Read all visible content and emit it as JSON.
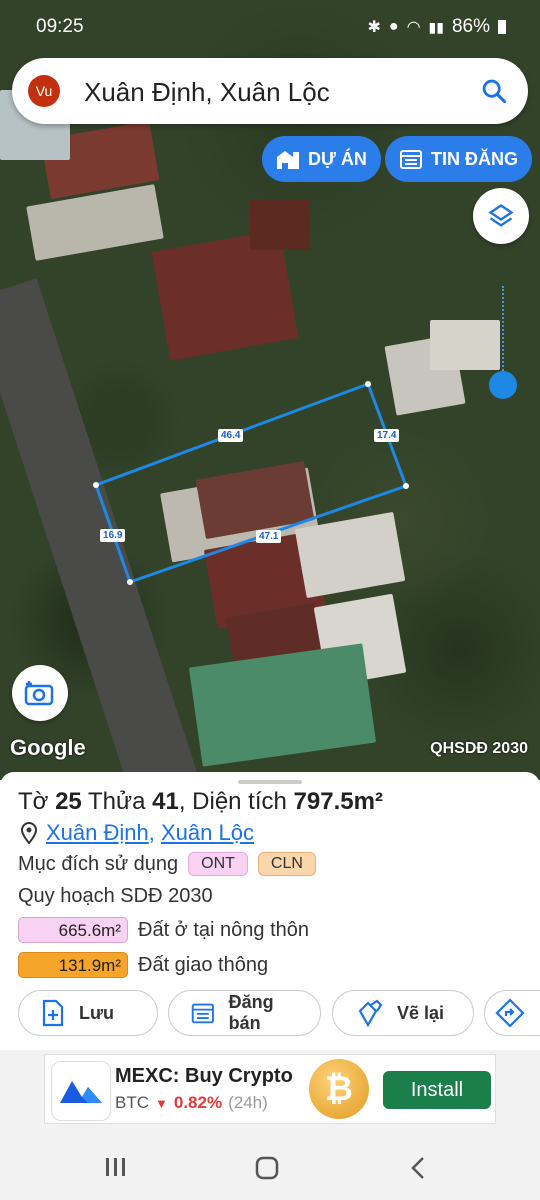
{
  "status": {
    "time": "09:25",
    "battery": "86%"
  },
  "search": {
    "avatar": "Vu",
    "query": "Xuân Định, Xuân Lộc"
  },
  "buttons": {
    "du_an": "DỰ ÁN",
    "tin_dang": "TIN ĐĂNG"
  },
  "map": {
    "attribution": "Google",
    "layer_label": "QHSDĐ 2030",
    "edges": {
      "top": "46.4",
      "right": "17.4",
      "left": "16.9",
      "bottom": "47.1"
    }
  },
  "parcel": {
    "sheet_prefix": "Tờ",
    "sheet_no": "25",
    "plot_prefix": "Thửa",
    "plot_no": "41",
    "area_prefix": "Diện tích",
    "area": "797.5m²",
    "commune": "Xuân Định",
    "separator": ",",
    "district": "Xuân Lộc",
    "usage_label": "Mục đích sử dụng",
    "usage_tags": [
      "ONT",
      "CLN"
    ],
    "planning_label": "Quy hoạch SDĐ 2030",
    "planning": [
      {
        "area": "665.6m²",
        "label": "Đất ở tại nông thôn",
        "color": "#f9d2f3"
      },
      {
        "area": "131.9m²",
        "label": "Đất giao thông",
        "color": "#f6a42a"
      }
    ]
  },
  "actions": {
    "save": "Lưu",
    "sell": "Đăng bán",
    "redraw": "Vẽ lại"
  },
  "ad": {
    "title": "MEXC: Buy Crypto",
    "ticker": "BTC",
    "change": "0.82%",
    "period": "(24h)",
    "cta": "Install"
  },
  "colors": {
    "accent": "#2b7de9",
    "install": "#1a7f4b",
    "down": "#e53935"
  }
}
